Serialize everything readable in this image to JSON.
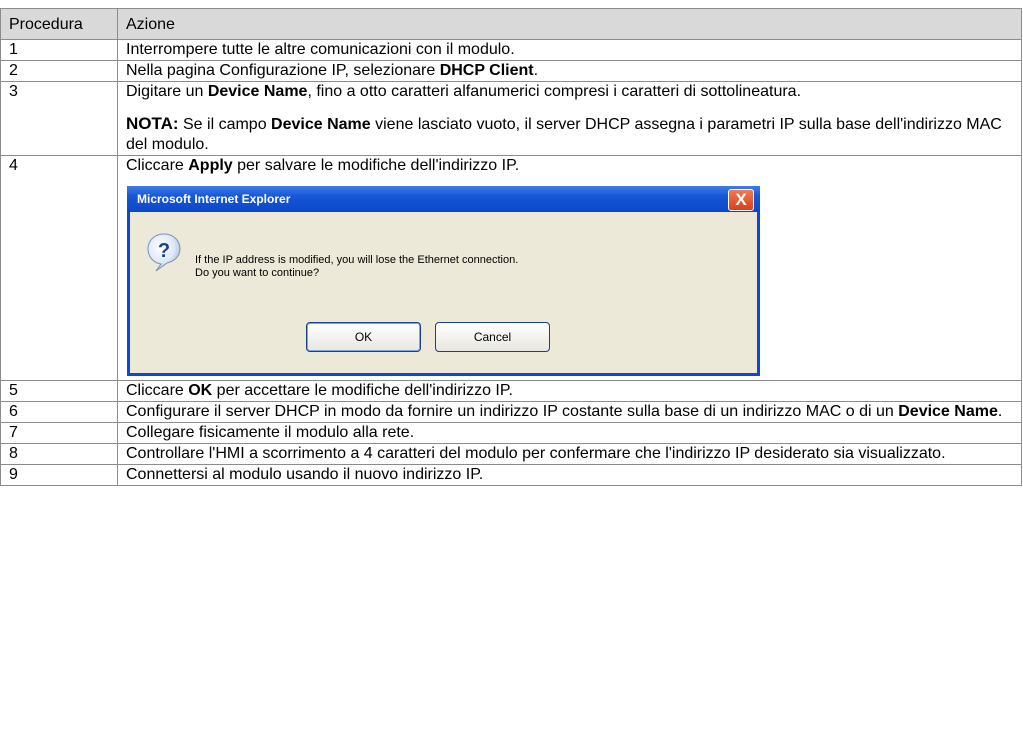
{
  "header": {
    "col_procedure": "Procedura",
    "col_action": "Azione"
  },
  "rows": {
    "r1": {
      "num": "1",
      "text": "Interrompere tutte le altre comunicazioni con il modulo."
    },
    "r2": {
      "num": "2",
      "pre": "Nella pagina Configurazione IP, selezionare ",
      "bold": "DHCP Client",
      "post": "."
    },
    "r3": {
      "num": "3",
      "pre": "Digitare un ",
      "bold": "Device Name",
      "post": ", fino a otto caratteri alfanumerici compresi i caratteri di sottolineatura.",
      "note_label": "NOTA:",
      "note_pre": " Se il campo ",
      "note_bold": "Device Name",
      "note_post": " viene lasciato vuoto, il server DHCP assegna i parametri IP sulla base dell'indirizzo MAC del modulo."
    },
    "r4": {
      "num": "4",
      "pre": "Cliccare ",
      "bold": "Apply",
      "post": " per salvare le modifiche dell'indirizzo IP."
    },
    "r5": {
      "num": "5",
      "pre": "Cliccare ",
      "bold": "OK",
      "post": " per accettare le modifiche dell'indirizzo IP."
    },
    "r6": {
      "num": "6",
      "pre": "Configurare il server DHCP in modo da fornire un indirizzo IP costante sulla base di un indirizzo MAC o di un ",
      "bold": "Device Name",
      "post": "."
    },
    "r7": {
      "num": "7",
      "text": "Collegare fisicamente il modulo alla rete."
    },
    "r8": {
      "num": "8",
      "text": "Controllare l'HMI a scorrimento a 4 caratteri del modulo per confermare che l'indirizzo IP desiderato sia visualizzato."
    },
    "r9": {
      "num": "9",
      "text": "Connettersi al modulo usando il nuovo indirizzo IP."
    }
  },
  "dialog": {
    "title": "Microsoft Internet Explorer",
    "close_glyph": "X",
    "icon": "question-icon",
    "message_line1": "If the IP address is modified, you will lose the Ethernet connection.",
    "message_line2": "Do you want to continue?",
    "ok_label": "OK",
    "cancel_label": "Cancel"
  }
}
